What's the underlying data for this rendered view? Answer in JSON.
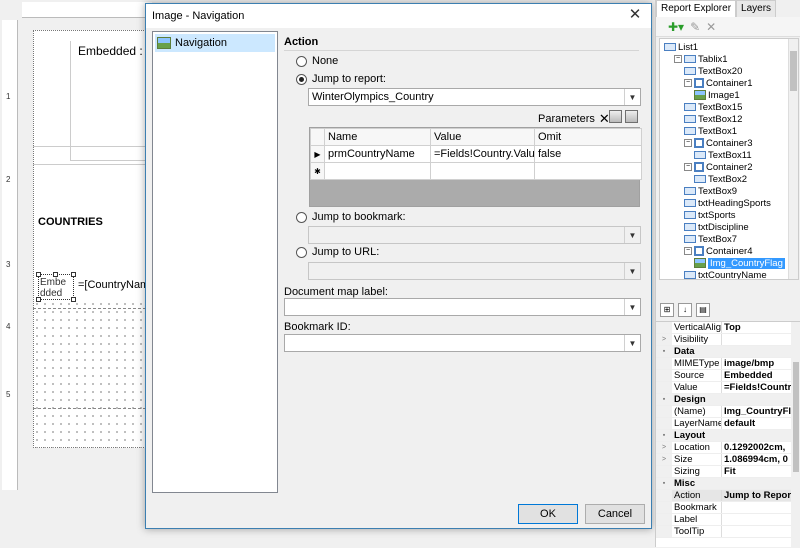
{
  "designer": {
    "embedded_text": "Embedded : =[",
    "countries_label": "COUNTRIES",
    "image_placeholder": "Embe dded",
    "country_name_expr": "=[CountryName",
    "ruler_numbers": [
      "1",
      "2",
      "3",
      "4",
      "5"
    ]
  },
  "dialog": {
    "title": "Image - Navigation",
    "close_glyph": "✕",
    "nav_items": [
      {
        "label": "Navigation"
      }
    ],
    "action_section": "Action",
    "options": {
      "none": "None",
      "jump_report": "Jump to report:",
      "jump_bookmark": "Jump to bookmark:",
      "jump_url": "Jump to URL:"
    },
    "selected_option": "jump_report",
    "report_value": "WinterOlympics_Country",
    "parameters_label": "Parameters",
    "parameters_columns": [
      "Name",
      "Value",
      "Omit"
    ],
    "parameters_rows": [
      {
        "name": "prmCountryName",
        "value": "=Fields!Country.Value",
        "omit": "false"
      }
    ],
    "new_row_marker": "✱",
    "current_row_marker": "▶",
    "document_map_label": "Document map label:",
    "bookmark_id_label": "Bookmark ID:",
    "ok_label": "OK",
    "cancel_label": "Cancel"
  },
  "right_panel": {
    "tabs": [
      "Report Explorer",
      "Layers"
    ],
    "active_tab": "Report Explorer",
    "tree": [
      {
        "label": "List1",
        "indent": 0,
        "icon": "list-icon",
        "expand": ""
      },
      {
        "label": "Tablix1",
        "indent": 1,
        "icon": "tablix-icon",
        "expand": "−"
      },
      {
        "label": "TextBox20",
        "indent": 2,
        "icon": "textbox-icon",
        "expand": ""
      },
      {
        "label": "Container1",
        "indent": 2,
        "icon": "container-icon",
        "expand": "−"
      },
      {
        "label": "Image1",
        "indent": 3,
        "icon": "image-icon",
        "expand": ""
      },
      {
        "label": "TextBox15",
        "indent": 2,
        "icon": "textbox-icon",
        "expand": ""
      },
      {
        "label": "TextBox12",
        "indent": 2,
        "icon": "textbox-icon",
        "expand": ""
      },
      {
        "label": "TextBox1",
        "indent": 2,
        "icon": "textbox-icon",
        "expand": ""
      },
      {
        "label": "Container3",
        "indent": 2,
        "icon": "container-icon",
        "expand": "−"
      },
      {
        "label": "TextBox11",
        "indent": 3,
        "icon": "textbox-icon",
        "expand": ""
      },
      {
        "label": "Container2",
        "indent": 2,
        "icon": "container-icon",
        "expand": "−"
      },
      {
        "label": "TextBox2",
        "indent": 3,
        "icon": "textbox-icon",
        "expand": ""
      },
      {
        "label": "TextBox9",
        "indent": 2,
        "icon": "textbox-icon",
        "expand": ""
      },
      {
        "label": "txtHeadingSports",
        "indent": 2,
        "icon": "textbox-icon",
        "expand": ""
      },
      {
        "label": "txtSports",
        "indent": 2,
        "icon": "textbox-icon",
        "expand": ""
      },
      {
        "label": "txtDiscipline",
        "indent": 2,
        "icon": "textbox-icon",
        "expand": ""
      },
      {
        "label": "TextBox7",
        "indent": 2,
        "icon": "textbox-icon",
        "expand": ""
      },
      {
        "label": "Container4",
        "indent": 2,
        "icon": "container-icon",
        "expand": "−"
      },
      {
        "label": "Img_CountryFlag",
        "indent": 3,
        "icon": "image-icon",
        "expand": "",
        "selected": true
      },
      {
        "label": "txtCountryName",
        "indent": 2,
        "icon": "textbox-icon",
        "expand": ""
      }
    ],
    "properties": [
      {
        "type": "row",
        "key": "VerticalAlign",
        "value": "Top"
      },
      {
        "type": "row",
        "key": "Visibility",
        "value": "",
        "expand": ">"
      },
      {
        "type": "cat",
        "key": "Data"
      },
      {
        "type": "row",
        "key": "MIMEType",
        "value": "image/bmp"
      },
      {
        "type": "row",
        "key": "Source",
        "value": "Embedded"
      },
      {
        "type": "row",
        "key": "Value",
        "value": "=Fields!Country"
      },
      {
        "type": "cat",
        "key": "Design"
      },
      {
        "type": "row",
        "key": "(Name)",
        "value": "Img_CountryFla"
      },
      {
        "type": "row",
        "key": "LayerName",
        "value": "default"
      },
      {
        "type": "cat",
        "key": "Layout"
      },
      {
        "type": "row",
        "key": "Location",
        "value": "0.1292002cm, ",
        "expand": ">"
      },
      {
        "type": "row",
        "key": "Size",
        "value": "1.086994cm, 0",
        "expand": ">"
      },
      {
        "type": "row",
        "key": "Sizing",
        "value": "Fit"
      },
      {
        "type": "cat",
        "key": "Misc"
      },
      {
        "type": "row",
        "key": "Action",
        "value": "Jump to Report",
        "highlight": true
      },
      {
        "type": "row",
        "key": "Bookmark",
        "value": ""
      },
      {
        "type": "row",
        "key": "Label",
        "value": ""
      },
      {
        "type": "row",
        "key": "ToolTip",
        "value": ""
      }
    ]
  },
  "colors": {
    "accent": "#0078d7",
    "selection": "#cce8ff",
    "tree_selection": "#3399ff"
  }
}
